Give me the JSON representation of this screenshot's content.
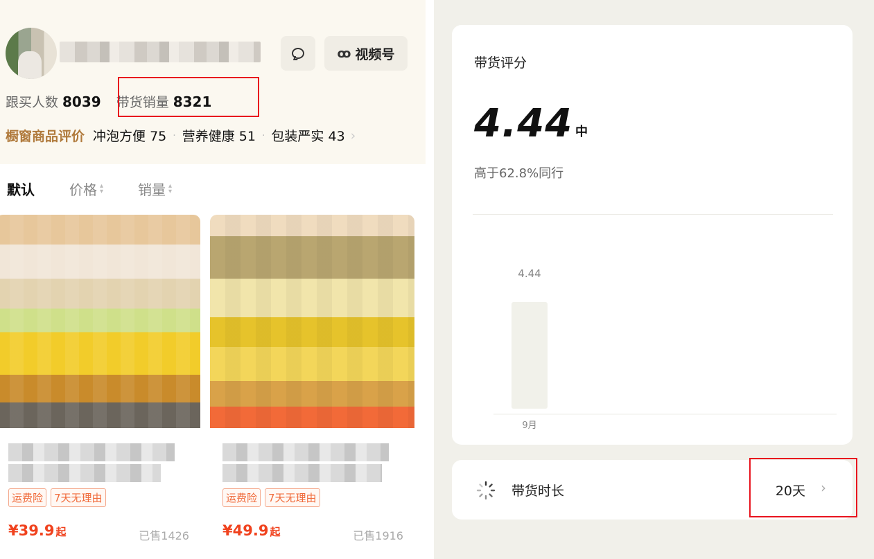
{
  "profile": {
    "video_label": "视频号",
    "followers_label": "跟买人数",
    "followers_value": "8039",
    "sales_label": "带货销量",
    "sales_value": "8321",
    "review_label": "橱窗商品评价",
    "review_tags": [
      {
        "name": "冲泡方便",
        "count": "75"
      },
      {
        "name": "营养健康",
        "count": "51"
      },
      {
        "name": "包装严实",
        "count": "43"
      }
    ],
    "chevron": "›"
  },
  "sort": {
    "default_label": "默认",
    "price_label": "价格",
    "sales_label": "销量"
  },
  "products": [
    {
      "badge1": "运费险",
      "badge2": "7天无理由",
      "price": "¥39.9",
      "price_suffix": "起",
      "sold": "已售1426"
    },
    {
      "badge1": "运费险",
      "badge2": "7天无理由",
      "price": "¥49.9",
      "price_suffix": "起",
      "sold": "已售1916"
    }
  ],
  "score": {
    "title": "带货评分",
    "value": "4.44",
    "level": "中",
    "compare": "高于62.8%同行"
  },
  "chart_data": {
    "type": "bar",
    "categories": [
      "9月"
    ],
    "values": [
      4.44
    ],
    "data_labels": [
      "4.44"
    ],
    "ylim": [
      0,
      5
    ],
    "grid": false,
    "bar_color": "#f1f1ea"
  },
  "duration": {
    "label": "带货时长",
    "value": "20天",
    "chevron": "›"
  },
  "colors": {
    "highlight_box": "#e8141e",
    "price": "#f0421e",
    "review_label": "#b07a3c"
  }
}
